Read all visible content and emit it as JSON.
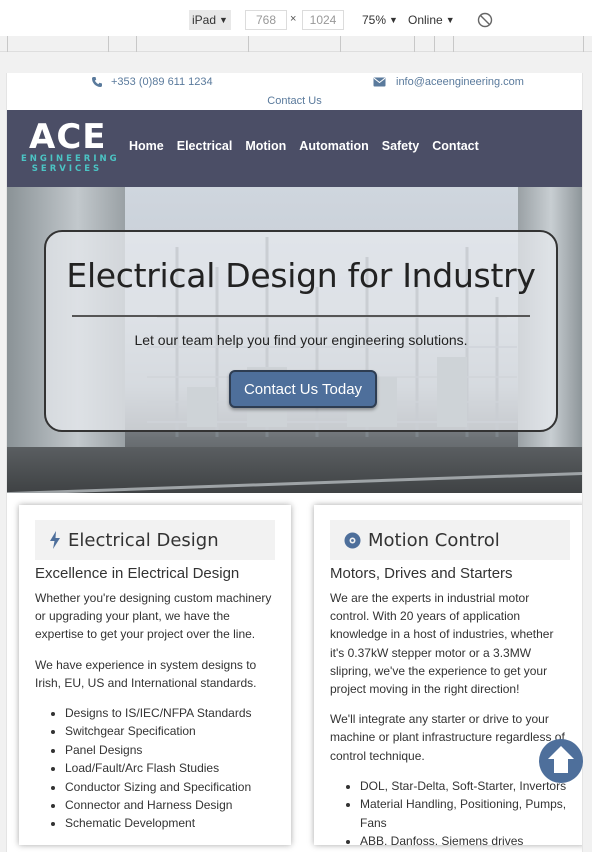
{
  "devtools": {
    "device": "iPad",
    "width": "768",
    "height": "1024",
    "times": "×",
    "zoom": "75%",
    "network": "Online",
    "caret": "▼"
  },
  "topbar": {
    "phone": "+353 (0)89 611 1234",
    "email": "info@aceengineering.com",
    "contact": "Contact Us"
  },
  "brand": {
    "name": "ACE",
    "sub1": "ENGINEERING",
    "sub2": "SERVICES",
    "accent": "#4bc4c4",
    "nav_bg": "#4b4e66"
  },
  "nav": [
    "Home",
    "Electrical",
    "Motion",
    "Automation",
    "Safety",
    "Contact"
  ],
  "hero": {
    "title": "Electrical Design for Industry",
    "subtitle": "Let our team help you find your engineering solutions.",
    "button": "Contact Us Today",
    "button_color": "#4e6f9b"
  },
  "cards": [
    {
      "icon": "lightning-icon",
      "title": "Electrical Design",
      "subtitle": "Excellence in Electrical Design",
      "paragraphs": [
        "Whether you're designing custom machinery or upgrading your plant, we have the expertise to get your project over the line.",
        "We have experience in system designs to Irish, EU, US and International standards."
      ],
      "items": [
        "Designs to IS/IEC/NFPA Standards",
        "Switchgear Specification",
        "Panel Designs",
        "Load/Fault/Arc Flash Studies",
        "Conductor Sizing and Specification",
        "Connector and Harness Design",
        "Schematic Development"
      ]
    },
    {
      "icon": "disc-icon",
      "title": "Motion Control",
      "subtitle": "Motors, Drives and Starters",
      "paragraphs": [
        "We are the experts in industrial motor control. With 20 years of application knowledge in a host of industries, whether it's 0.37kW stepper motor or a 3.3MW slipring, we've the experience to get your project moving in the right direction!",
        "We'll integrate any starter or drive to your machine or plant infrastructure regardless of control technique."
      ],
      "items": [
        "DOL, Star-Delta, Soft-Starter, Invertors",
        "Material Handling, Positioning, Pumps, Fans",
        "ABB, Danfoss, Siemens drives"
      ]
    }
  ]
}
